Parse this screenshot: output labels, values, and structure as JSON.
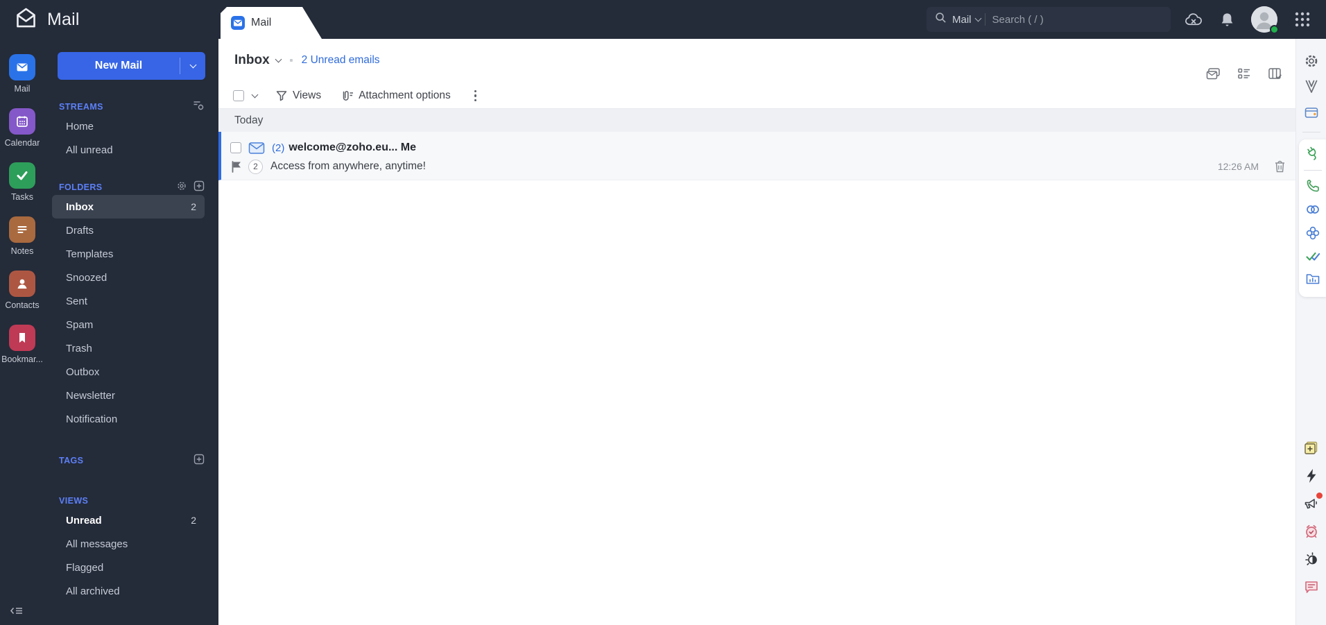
{
  "topbar": {
    "app_title": "Mail",
    "tab_label": "Mail",
    "search_scope": "Mail",
    "search_placeholder": "Search ( / )",
    "icons": [
      "zoho-mail-logo",
      "search-icon",
      "chevron-down-icon",
      "cloud-offline-icon",
      "bell-icon",
      "avatar",
      "apps-grid-icon"
    ]
  },
  "app_rail": {
    "items": [
      {
        "label": "Mail",
        "color": "#2a72e8",
        "icon": "mail-icon"
      },
      {
        "label": "Calendar",
        "color": "#8458c8",
        "icon": "calendar-icon"
      },
      {
        "label": "Tasks",
        "color": "#2e9e5b",
        "icon": "tasks-check-icon"
      },
      {
        "label": "Notes",
        "color": "#a96a3f",
        "icon": "notes-icon"
      },
      {
        "label": "Contacts",
        "color": "#ad5743",
        "icon": "contacts-person-icon"
      },
      {
        "label": "Bookmar...",
        "color": "#bf3a55",
        "icon": "bookmark-icon"
      }
    ]
  },
  "sidebar": {
    "new_mail_label": "New Mail",
    "streams": {
      "title": "STREAMS",
      "items": [
        {
          "label": "Home"
        },
        {
          "label": "All unread"
        }
      ]
    },
    "folders": {
      "title": "FOLDERS",
      "items": [
        {
          "label": "Inbox",
          "count": "2"
        },
        {
          "label": "Drafts"
        },
        {
          "label": "Templates"
        },
        {
          "label": "Snoozed"
        },
        {
          "label": "Sent"
        },
        {
          "label": "Spam"
        },
        {
          "label": "Trash"
        },
        {
          "label": "Outbox"
        },
        {
          "label": "Newsletter"
        },
        {
          "label": "Notification"
        }
      ]
    },
    "tags": {
      "title": "TAGS"
    },
    "views": {
      "title": "VIEWS",
      "items": [
        {
          "label": "Unread",
          "count": "2"
        },
        {
          "label": "All messages"
        },
        {
          "label": "Flagged"
        },
        {
          "label": "All archived"
        }
      ]
    }
  },
  "main": {
    "title": "Inbox",
    "unread_link": "2 Unread emails",
    "toolbar": {
      "views_label": "Views",
      "attachment_label": "Attachment options",
      "icons": [
        "checkbox",
        "chevron-down-icon",
        "filter-funnel-icon",
        "attachment-clip-icon",
        "more-dots-icon"
      ]
    },
    "list_header_icons": [
      "reading-pane-icon",
      "list-view-icon",
      "column-view-icon"
    ],
    "group_header": "Today",
    "email": {
      "prefix": "(2)",
      "sender": "welcome@zoho.eu... Me",
      "badge": "2",
      "subject": "Access from anywhere, anytime!",
      "time": "12:26 AM",
      "icons": [
        "unread-envelope-icon",
        "flag-icon",
        "trash-icon"
      ]
    }
  },
  "right_rail": {
    "top_icons": [
      "settings-gear-icon",
      "vault-clip-icon",
      "wallet-icon"
    ],
    "card_icons": [
      "plug-icon",
      "phone-icon",
      "rings-icon",
      "clover-icon",
      "double-check-icon",
      "folder-chart-icon"
    ],
    "bottom_icons": [
      "sticky-note-icon",
      "lightning-icon",
      "megaphone-icon",
      "alarm-clock-icon",
      "night-mode-icon",
      "feedback-chat-icon"
    ]
  },
  "colors": {
    "topbar_bg": "#242b39",
    "accent_blue": "#3765e6",
    "section_header_blue": "#5c80f7",
    "link_blue": "#2f6bdb",
    "unread_bar_blue": "#2d6ce4",
    "selected_item_bg": "#3b4351",
    "today_bg": "#eef0f4",
    "row_bg": "#f6f8fa",
    "online_green": "#21b24b",
    "alert_red": "#e8443a"
  }
}
